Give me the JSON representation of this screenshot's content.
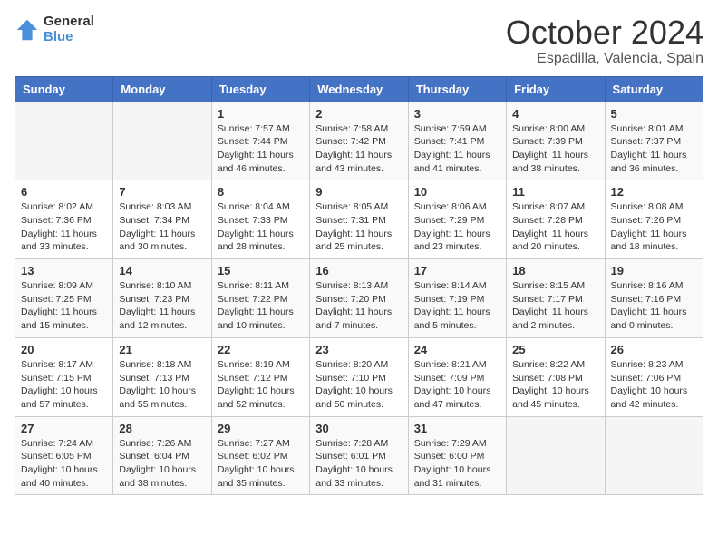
{
  "logo": {
    "line1": "General",
    "line2": "Blue"
  },
  "header": {
    "month": "October 2024",
    "location": "Espadilla, Valencia, Spain"
  },
  "weekdays": [
    "Sunday",
    "Monday",
    "Tuesday",
    "Wednesday",
    "Thursday",
    "Friday",
    "Saturday"
  ],
  "weeks": [
    [
      {
        "day": "",
        "info": ""
      },
      {
        "day": "",
        "info": ""
      },
      {
        "day": "1",
        "info": "Sunrise: 7:57 AM\nSunset: 7:44 PM\nDaylight: 11 hours and 46 minutes."
      },
      {
        "day": "2",
        "info": "Sunrise: 7:58 AM\nSunset: 7:42 PM\nDaylight: 11 hours and 43 minutes."
      },
      {
        "day": "3",
        "info": "Sunrise: 7:59 AM\nSunset: 7:41 PM\nDaylight: 11 hours and 41 minutes."
      },
      {
        "day": "4",
        "info": "Sunrise: 8:00 AM\nSunset: 7:39 PM\nDaylight: 11 hours and 38 minutes."
      },
      {
        "day": "5",
        "info": "Sunrise: 8:01 AM\nSunset: 7:37 PM\nDaylight: 11 hours and 36 minutes."
      }
    ],
    [
      {
        "day": "6",
        "info": "Sunrise: 8:02 AM\nSunset: 7:36 PM\nDaylight: 11 hours and 33 minutes."
      },
      {
        "day": "7",
        "info": "Sunrise: 8:03 AM\nSunset: 7:34 PM\nDaylight: 11 hours and 30 minutes."
      },
      {
        "day": "8",
        "info": "Sunrise: 8:04 AM\nSunset: 7:33 PM\nDaylight: 11 hours and 28 minutes."
      },
      {
        "day": "9",
        "info": "Sunrise: 8:05 AM\nSunset: 7:31 PM\nDaylight: 11 hours and 25 minutes."
      },
      {
        "day": "10",
        "info": "Sunrise: 8:06 AM\nSunset: 7:29 PM\nDaylight: 11 hours and 23 minutes."
      },
      {
        "day": "11",
        "info": "Sunrise: 8:07 AM\nSunset: 7:28 PM\nDaylight: 11 hours and 20 minutes."
      },
      {
        "day": "12",
        "info": "Sunrise: 8:08 AM\nSunset: 7:26 PM\nDaylight: 11 hours and 18 minutes."
      }
    ],
    [
      {
        "day": "13",
        "info": "Sunrise: 8:09 AM\nSunset: 7:25 PM\nDaylight: 11 hours and 15 minutes."
      },
      {
        "day": "14",
        "info": "Sunrise: 8:10 AM\nSunset: 7:23 PM\nDaylight: 11 hours and 12 minutes."
      },
      {
        "day": "15",
        "info": "Sunrise: 8:11 AM\nSunset: 7:22 PM\nDaylight: 11 hours and 10 minutes."
      },
      {
        "day": "16",
        "info": "Sunrise: 8:13 AM\nSunset: 7:20 PM\nDaylight: 11 hours and 7 minutes."
      },
      {
        "day": "17",
        "info": "Sunrise: 8:14 AM\nSunset: 7:19 PM\nDaylight: 11 hours and 5 minutes."
      },
      {
        "day": "18",
        "info": "Sunrise: 8:15 AM\nSunset: 7:17 PM\nDaylight: 11 hours and 2 minutes."
      },
      {
        "day": "19",
        "info": "Sunrise: 8:16 AM\nSunset: 7:16 PM\nDaylight: 11 hours and 0 minutes."
      }
    ],
    [
      {
        "day": "20",
        "info": "Sunrise: 8:17 AM\nSunset: 7:15 PM\nDaylight: 10 hours and 57 minutes."
      },
      {
        "day": "21",
        "info": "Sunrise: 8:18 AM\nSunset: 7:13 PM\nDaylight: 10 hours and 55 minutes."
      },
      {
        "day": "22",
        "info": "Sunrise: 8:19 AM\nSunset: 7:12 PM\nDaylight: 10 hours and 52 minutes."
      },
      {
        "day": "23",
        "info": "Sunrise: 8:20 AM\nSunset: 7:10 PM\nDaylight: 10 hours and 50 minutes."
      },
      {
        "day": "24",
        "info": "Sunrise: 8:21 AM\nSunset: 7:09 PM\nDaylight: 10 hours and 47 minutes."
      },
      {
        "day": "25",
        "info": "Sunrise: 8:22 AM\nSunset: 7:08 PM\nDaylight: 10 hours and 45 minutes."
      },
      {
        "day": "26",
        "info": "Sunrise: 8:23 AM\nSunset: 7:06 PM\nDaylight: 10 hours and 42 minutes."
      }
    ],
    [
      {
        "day": "27",
        "info": "Sunrise: 7:24 AM\nSunset: 6:05 PM\nDaylight: 10 hours and 40 minutes."
      },
      {
        "day": "28",
        "info": "Sunrise: 7:26 AM\nSunset: 6:04 PM\nDaylight: 10 hours and 38 minutes."
      },
      {
        "day": "29",
        "info": "Sunrise: 7:27 AM\nSunset: 6:02 PM\nDaylight: 10 hours and 35 minutes."
      },
      {
        "day": "30",
        "info": "Sunrise: 7:28 AM\nSunset: 6:01 PM\nDaylight: 10 hours and 33 minutes."
      },
      {
        "day": "31",
        "info": "Sunrise: 7:29 AM\nSunset: 6:00 PM\nDaylight: 10 hours and 31 minutes."
      },
      {
        "day": "",
        "info": ""
      },
      {
        "day": "",
        "info": ""
      }
    ]
  ]
}
